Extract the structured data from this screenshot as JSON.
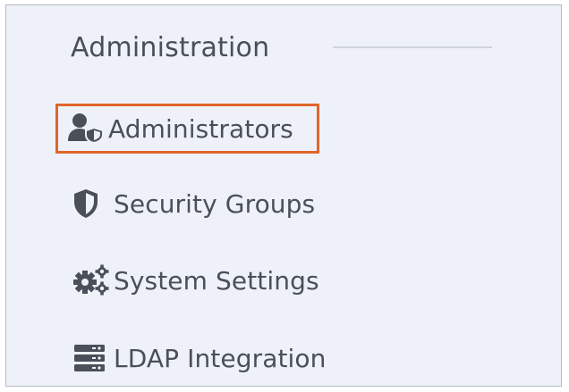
{
  "section": {
    "title": "Administration"
  },
  "menu": {
    "items": [
      {
        "label": "Administrators",
        "icon": "user-shield-icon",
        "active": true
      },
      {
        "label": "Security Groups",
        "icon": "shield-icon",
        "active": false
      },
      {
        "label": "System Settings",
        "icon": "gears-icon",
        "active": false
      },
      {
        "label": "LDAP Integration",
        "icon": "server-icon",
        "active": false
      }
    ]
  },
  "colors": {
    "panel_background": "#eef2f8",
    "text": "#4a4f59",
    "active_outline": "#e0662a"
  }
}
